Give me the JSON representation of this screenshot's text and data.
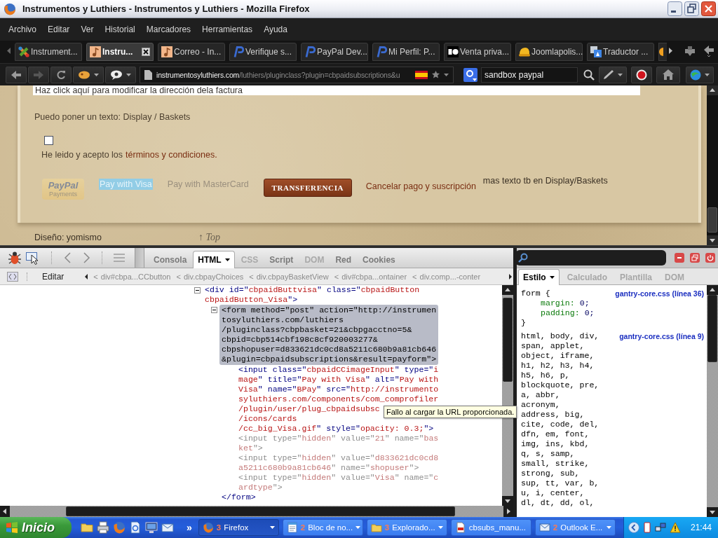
{
  "window": {
    "title": "Instrumentos y Luthiers - Instrumentos y Luthiers - Mozilla Firefox"
  },
  "menu": [
    "Archivo",
    "Editar",
    "Ver",
    "Historial",
    "Marcadores",
    "Herramientas",
    "Ayuda"
  ],
  "tabs": [
    {
      "label": "Instrument...",
      "selected": false
    },
    {
      "label": "Instru...",
      "selected": true
    },
    {
      "label": "Correo - In...",
      "selected": false
    },
    {
      "label": "Verifique s...",
      "selected": false
    },
    {
      "label": "PayPal Dev...",
      "selected": false
    },
    {
      "label": "Mi Perfil: P...",
      "selected": false
    },
    {
      "label": "Venta priva...",
      "selected": false
    },
    {
      "label": "Joomlapolis...",
      "selected": false
    },
    {
      "label": "Traductor ...",
      "selected": false
    }
  ],
  "navbar": {
    "url": {
      "host": "instrumentosyluthiers.com",
      "path": "/luthiers/pluginclass?plugin=cbpaidsubscriptions&u"
    },
    "search": {
      "value": "sandbox paypal"
    }
  },
  "page": {
    "address_notice": "Haz click aquí para modificar la dirección dela factura",
    "basket_text": "Puedo poner un texto: Display / Baskets",
    "terms": {
      "checked": false,
      "text": "He leido y acepto los",
      "link": "términos y condiciones."
    },
    "payment_options": [
      {
        "kind": "logo",
        "label": "PayPal",
        "caption": "Payments",
        "highlighted": false
      },
      {
        "kind": "alt_text",
        "label": "Pay with Visa",
        "highlighted": true
      },
      {
        "kind": "alt_text",
        "label": "Pay with MasterCard",
        "highlighted": false
      },
      {
        "kind": "button",
        "label": "TRANSFERENCIA",
        "highlighted": false
      },
      {
        "kind": "link",
        "label": "Cancelar pago y suscripción",
        "highlighted": false
      }
    ],
    "extra_text": "mas texto tb en Display/Baskets",
    "footer": {
      "credit": "Diseño: yomismo",
      "top_link": "↑ Top"
    }
  },
  "firebug": {
    "tabs": [
      {
        "label": "Consola",
        "selected": false,
        "disabled": false
      },
      {
        "label": "HTML",
        "selected": true,
        "disabled": false
      },
      {
        "label": "CSS",
        "selected": false,
        "disabled": true
      },
      {
        "label": "Script",
        "selected": false,
        "disabled": false
      },
      {
        "label": "DOM",
        "selected": false,
        "disabled": true
      },
      {
        "label": "Red",
        "selected": false,
        "disabled": false
      },
      {
        "label": "Cookies",
        "selected": false,
        "disabled": false
      }
    ],
    "edit_button": "Editar",
    "breadcrumbs": [
      {
        "separator": "<",
        "label": "div#cbpa...CCbutton"
      },
      {
        "separator": "<",
        "label": "div.cbpayChoices"
      },
      {
        "separator": "<",
        "label": "div.cbpayBasketView"
      },
      {
        "separator": "<",
        "label": "div#cbpa...ontainer"
      },
      {
        "separator": "<",
        "label": "div.comp...-conter"
      }
    ],
    "html_panel": {
      "nodes": [
        {
          "expanded": true,
          "selected": false,
          "faded": false,
          "lines": [
            [
              {
                "kind": "markup",
                "text": "<div id=\""
              },
              {
                "kind": "value",
                "text": "cbpaidButtvisa"
              },
              {
                "kind": "markup",
                "text": "\" class=\""
              },
              {
                "kind": "value",
                "text": "cbpaidButton"
              }
            ],
            [
              {
                "kind": "value",
                "text": "cbpaidButton_Visa"
              },
              {
                "kind": "markup",
                "text": "\">"
              }
            ]
          ],
          "children": [
            {
              "expanded": true,
              "selected": true,
              "faded": false,
              "lines": [
                "<form method=\"post\" action=\"http://instrumen",
                "tosyluthiers.com/luthiers",
                "/pluginclass?cbpbasket=21&cbpgacctno=5&",
                "cbpid=cbp514cbf198c8cf920003277&",
                "cbpshopuser=d833621dc0cd8a5211c680b9a81cb646",
                "&plugin=cbpaidsubscriptions&result=payform\">"
              ],
              "closing": "</form>",
              "children": [
                {
                  "selected": false,
                  "faded": false,
                  "lines": [
                    [
                      {
                        "kind": "markup",
                        "text": "<input class=\""
                      },
                      {
                        "kind": "value",
                        "text": "cbpaidCCimageInput"
                      },
                      {
                        "kind": "markup",
                        "text": "\" type=\""
                      },
                      {
                        "kind": "value",
                        "text": "i"
                      }
                    ],
                    [
                      {
                        "kind": "value",
                        "text": "mage"
                      },
                      {
                        "kind": "markup",
                        "text": "\" title=\""
                      },
                      {
                        "kind": "value",
                        "text": "Pay with Visa"
                      },
                      {
                        "kind": "markup",
                        "text": "\" alt=\""
                      },
                      {
                        "kind": "value",
                        "text": "Pay with"
                      }
                    ],
                    [
                      {
                        "kind": "value",
                        "text": "Visa"
                      },
                      {
                        "kind": "markup",
                        "text": "\" name=\""
                      },
                      {
                        "kind": "value",
                        "text": "BPay"
                      },
                      {
                        "kind": "markup",
                        "text": "\" src=\""
                      },
                      {
                        "kind": "value",
                        "text": "http://instrumento"
                      }
                    ],
                    [
                      {
                        "kind": "value",
                        "text": "syluthiers.com/components/com_comprofiler"
                      }
                    ],
                    [
                      {
                        "kind": "value",
                        "text": "/plugin/user/plug_cbpaidsubsc"
                      }
                    ],
                    [
                      {
                        "kind": "value",
                        "text": "/icons/cards"
                      }
                    ],
                    [
                      {
                        "kind": "value",
                        "text": "/cc_big_Visa.gif"
                      },
                      {
                        "kind": "markup",
                        "text": "\" style=\""
                      },
                      {
                        "kind": "value",
                        "text": "opacity: 0.3;"
                      },
                      {
                        "kind": "markup",
                        "text": "\">"
                      }
                    ]
                  ]
                },
                {
                  "selected": false,
                  "faded": true,
                  "lines": [
                    [
                      {
                        "kind": "markup",
                        "text": "<input type=\""
                      },
                      {
                        "kind": "value",
                        "text": "hidden"
                      },
                      {
                        "kind": "markup",
                        "text": "\" value=\""
                      },
                      {
                        "kind": "value",
                        "text": "21"
                      },
                      {
                        "kind": "markup",
                        "text": "\" name=\""
                      },
                      {
                        "kind": "value",
                        "text": "bas"
                      }
                    ],
                    [
                      {
                        "kind": "value",
                        "text": "ket"
                      },
                      {
                        "kind": "markup",
                        "text": "\">"
                      }
                    ]
                  ]
                },
                {
                  "selected": false,
                  "faded": true,
                  "lines": [
                    [
                      {
                        "kind": "markup",
                        "text": "<input type=\""
                      },
                      {
                        "kind": "value",
                        "text": "hidden"
                      },
                      {
                        "kind": "markup",
                        "text": "\" value=\""
                      },
                      {
                        "kind": "value",
                        "text": "d833621dc0cd8"
                      }
                    ],
                    [
                      {
                        "kind": "value",
                        "text": "a5211c680b9a81cb646"
                      },
                      {
                        "kind": "markup",
                        "text": "\" name=\""
                      },
                      {
                        "kind": "value",
                        "text": "shopuser"
                      },
                      {
                        "kind": "markup",
                        "text": "\">"
                      }
                    ]
                  ]
                },
                {
                  "selected": false,
                  "faded": true,
                  "lines": [
                    [
                      {
                        "kind": "markup",
                        "text": "<input type=\""
                      },
                      {
                        "kind": "value",
                        "text": "hidden"
                      },
                      {
                        "kind": "markup",
                        "text": "\" value=\""
                      },
                      {
                        "kind": "value",
                        "text": "Visa"
                      },
                      {
                        "kind": "markup",
                        "text": "\" name=\""
                      },
                      {
                        "kind": "value",
                        "text": "c"
                      }
                    ],
                    [
                      {
                        "kind": "value",
                        "text": "ardtype"
                      },
                      {
                        "kind": "markup",
                        "text": "\">"
                      }
                    ]
                  ]
                }
              ]
            }
          ]
        }
      ],
      "tooltip": "Fallo al cargar la URL proporcionada."
    },
    "side_tabs": [
      {
        "label": "Estilo",
        "selected": true
      },
      {
        "label": "Calculado",
        "selected": false
      },
      {
        "label": "Plantilla",
        "selected": false
      },
      {
        "label": "DOM",
        "selected": false
      }
    ],
    "style_rules": [
      {
        "selector_lines": [
          "form {"
        ],
        "source": "gantry-core.css (línea 36)",
        "properties": [
          {
            "name": "margin:",
            "value": "0;"
          },
          {
            "name": "padding:",
            "value": "0;"
          }
        ],
        "closing": "}"
      },
      {
        "selector_lines": [
          "html, body, div,",
          "span, applet,",
          "object, iframe,",
          "h1, h2, h3, h4,",
          "h5, h6, p,",
          "blockquote, pre,",
          "a, abbr,",
          "acronym,",
          "address, big,",
          "cite, code, del,",
          "dfn, em, font,",
          "img, ins, kbd,",
          "q, s, samp,",
          "small, strike,",
          "strong, sub,",
          "sup, tt, var, b,",
          "u, i, center,",
          "dl, dt, dd, ol,"
        ],
        "source": "gantry-core.css (línea 9)"
      }
    ]
  },
  "taskbar": {
    "start": "Inicio",
    "overflow": "»",
    "tasks": [
      {
        "count": "3",
        "label": "Firefox",
        "selected": true
      },
      {
        "count": "2",
        "label": "Bloc de no...",
        "selected": false
      },
      {
        "count": "3",
        "label": "Explorado...",
        "selected": false
      },
      {
        "label": "cbsubs_manu...",
        "selected": false
      },
      {
        "count": "2",
        "label": "Outlook E...",
        "selected": false
      }
    ],
    "clock": "21:44"
  }
}
